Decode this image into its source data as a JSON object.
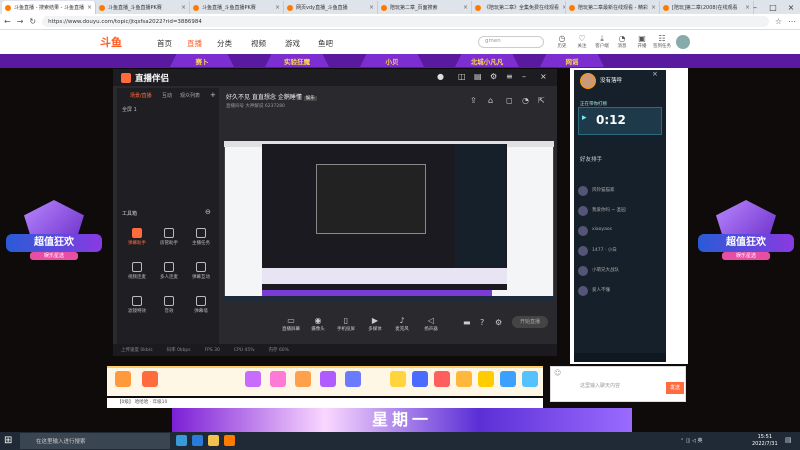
{
  "browser": {
    "tabs": [
      {
        "label": "斗鱼直播 - 搜索结果 - 斗鱼直播"
      },
      {
        "label": "斗鱼直播_斗鱼直播PK赛"
      },
      {
        "label": "斗鱼直播_斗鱼直播PK赛"
      },
      {
        "label": "网页vdy直播_斗鱼直播"
      },
      {
        "label": "陪玩第二章_页面搜索"
      },
      {
        "label": "《陪玩第二章》全集免费在线观看"
      },
      {
        "label": "陪玩第二章最新在线观看 - 精彩"
      },
      {
        "label": "[陪玩]第二章(2008)在线观看"
      }
    ],
    "url": "https://www.douyu.com/topic/jtqsfsa2022?rid=3886984"
  },
  "site": {
    "logo": "斗鱼",
    "nav": [
      "首页",
      "直播",
      "分类",
      "视频",
      "游戏",
      "鱼吧"
    ],
    "search_placeholder": "gmen",
    "header_icons": [
      {
        "label": "历史",
        "icon": "clock-icon"
      },
      {
        "label": "关注",
        "icon": "heart-icon"
      },
      {
        "label": "客户端",
        "icon": "download-icon"
      },
      {
        "label": "消息",
        "icon": "bell-icon"
      },
      {
        "label": "开播",
        "icon": "camera-icon"
      },
      {
        "label": "签到任务",
        "icon": "task-icon"
      }
    ],
    "purple_tabs": [
      "赛卜",
      "实验狂魔",
      "小贝",
      "北城小凡凡",
      "网谣"
    ]
  },
  "badges": {
    "title": "超值狂欢",
    "subtitle": "娱乐星选"
  },
  "app": {
    "logo": "直播伴侣",
    "sidebar_tabs": [
      "场景/直播",
      "互动",
      "观众列表"
    ],
    "scene": "全屏 1",
    "tools_title": "工具箱",
    "tools": [
      {
        "label": "弹幕助手",
        "active": true
      },
      {
        "label": "房管助手",
        "active": false
      },
      {
        "label": "主播任务",
        "active": false
      },
      {
        "label": "视频连麦",
        "active": false
      },
      {
        "label": "多人连麦",
        "active": false
      },
      {
        "label": "弹幕互动",
        "active": false
      },
      {
        "label": "滤镜特效",
        "active": false
      },
      {
        "label": "音效",
        "active": false
      },
      {
        "label": "弹幕墙",
        "active": false
      }
    ],
    "room_title": "好久不见 直直想念 企鹅睡懂",
    "room_tag": "娱乐",
    "room_sub": "直播间号 大神解说",
    "room_id": "6237280",
    "bottom_buttons": [
      {
        "label": "直播屏幕",
        "icon": "screen-icon"
      },
      {
        "label": "摄像头",
        "icon": "camera-icon"
      },
      {
        "label": "手机投屏",
        "icon": "phone-icon"
      },
      {
        "label": "多媒体",
        "icon": "media-icon"
      },
      {
        "label": "麦克风",
        "icon": "mic-icon"
      },
      {
        "label": "扬声器",
        "icon": "speaker-icon"
      }
    ],
    "start_live": "开始直播",
    "status": [
      "上传速度 0kb/s",
      "码率 0kbps",
      "FPS 30",
      "CPU 45%",
      "内存 60%"
    ]
  },
  "right_panel": {
    "anchor_name": "没有落呼",
    "timer_label": "正在带你打榜",
    "timer": "0:12",
    "friends_title": "好友排手",
    "friend_list": [
      "风铃猫猫家",
      "我爱你吗 ~ 圣园",
      "xiaoyaos",
      "1477 · 小白",
      "小萌兄大战队",
      "爱人不懂"
    ],
    "chat_placeholder": "这里输入聊天内容",
    "send": "发送"
  },
  "footer": {
    "label": "【0级】 哈哈哈 · 年级10",
    "banner": "星期一"
  },
  "taskbar": {
    "search_placeholder": "在这里输入进行搜索",
    "time": "15:51",
    "date": "2022/7/31"
  }
}
